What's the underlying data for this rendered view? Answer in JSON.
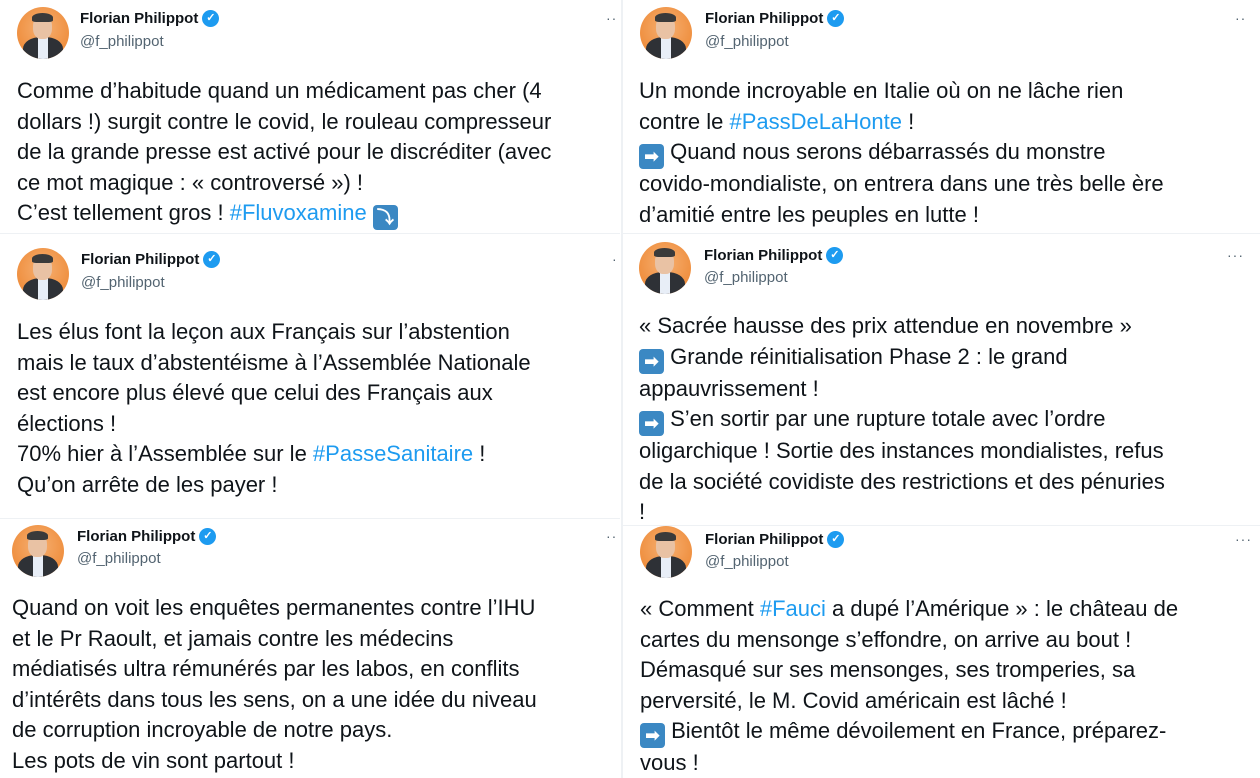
{
  "author": {
    "name": "Florian Philippot",
    "handle": "@f_philippot"
  },
  "tweets": [
    {
      "more": "··",
      "lines": [
        [
          "Comme d’habitude quand un médicament pas cher (4"
        ],
        [
          "dollars !) surgit contre le covid, le rouleau compresseur"
        ],
        [
          "de la grande presse est activé pour le discréditer (avec"
        ],
        [
          "ce mot magique : « controversé ») !"
        ],
        [
          "C’est tellement gros ! ",
          "#Fluvoxamine",
          " ",
          "⤵"
        ]
      ]
    },
    {
      "more": "··",
      "lines": [
        [
          "Un monde incroyable en Italie où on ne lâche rien"
        ],
        [
          "contre le ",
          "#PassDeLaHonte",
          " !"
        ],
        [
          "➡",
          " Quand nous serons débarrassés du monstre"
        ],
        [
          "covido-mondialiste, on entrera dans une très belle ère"
        ],
        [
          "d’amitié entre les peuples en lutte !"
        ]
      ]
    },
    {
      "more": "·",
      "lines": [
        [
          "Les élus font la leçon aux Français sur l’abstention"
        ],
        [
          "mais le taux d’abstentéisme à l’Assemblée Nationale"
        ],
        [
          "est encore plus élevé que celui des Français aux"
        ],
        [
          "élections !"
        ],
        [
          "70% hier à l’Assemblée sur le ",
          "#PasseSanitaire",
          " !"
        ],
        [
          "Qu’on arrête de les payer !"
        ]
      ]
    },
    {
      "more": "···",
      "lines": [
        [
          "« Sacrée hausse des prix attendue en novembre »"
        ],
        [
          "➡",
          " Grande réinitialisation Phase 2 : le grand"
        ],
        [
          "appauvrissement !"
        ],
        [
          "➡",
          " S’en sortir par une rupture totale avec l’ordre"
        ],
        [
          "oligarchique ! Sortie des instances mondialistes, refus"
        ],
        [
          "de la société covidiste des restrictions et des pénuries"
        ],
        [
          "!"
        ]
      ]
    },
    {
      "more": "··",
      "lines": [
        [
          "Quand on voit les enquêtes permanentes contre l’IHU"
        ],
        [
          "et le Pr Raoult, et jamais contre les médecins"
        ],
        [
          "médiatisés ultra rémunérés par les labos, en conflits"
        ],
        [
          "d’intérêts dans tous les sens, on a une idée du niveau"
        ],
        [
          "de corruption incroyable de notre pays."
        ],
        [
          "Les pots de vin sont partout !"
        ]
      ]
    },
    {
      "more": "···",
      "lines": [
        [
          "« Comment ",
          "#Fauci",
          " a dupé l’Amérique » : le château de"
        ],
        [
          "cartes du mensonge s’effondre, on arrive au bout !"
        ],
        [
          "Démasqué sur ses mensonges, ses tromperies, sa"
        ],
        [
          "perversité, le M. Covid américain est lâché !"
        ],
        [
          "➡",
          " Bientôt le même dévoilement en France, préparez-"
        ],
        [
          "vous !"
        ]
      ]
    }
  ]
}
